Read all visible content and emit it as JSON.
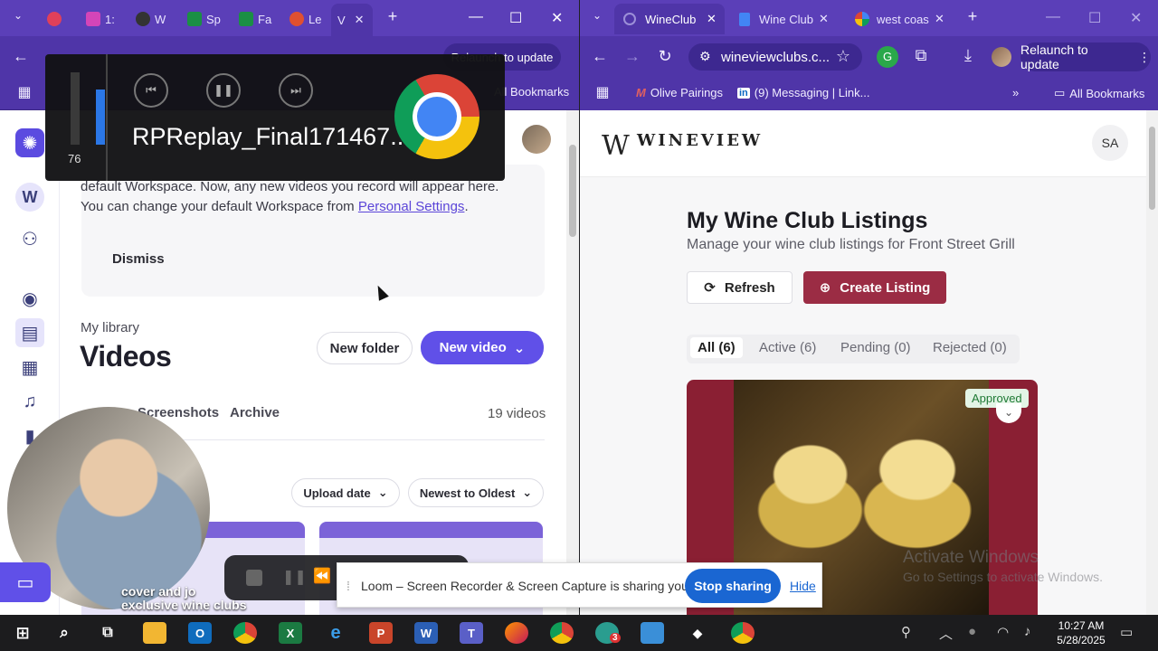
{
  "left_browser": {
    "tabs": [
      {
        "label": "",
        "color": "#e0405a"
      },
      {
        "label": "1:",
        "color": "#d445b8"
      },
      {
        "label": "W",
        "color": "#333333"
      },
      {
        "label": "Sp",
        "color": "#1b8f45"
      },
      {
        "label": "Fa",
        "color": "#1b8f45"
      },
      {
        "label": "Le",
        "color": "#e05030"
      },
      {
        "label": "V",
        "color": "#6a55e0"
      }
    ],
    "update_label": "Relaunch to update",
    "bookmarks_label": "All Bookmarks"
  },
  "media_overlay": {
    "title": "RPReplay_Final171467...",
    "volume": 76,
    "volume_fraction": 0.76
  },
  "loom": {
    "rail_icons": [
      "loom-logo-icon",
      "workspace-icon",
      "add-user-icon",
      "profile-icon",
      "library-icon",
      "calendar-icon",
      "bell-icon",
      "bookmark-icon"
    ],
    "workspace_letter": "W",
    "notice_text_lead": "default Workspace. Now, any new videos you record will appear here. You can change your default Workspace from ",
    "notice_link": "Personal Settings",
    "notice_text_end": ".",
    "dismiss_label": "Dismiss",
    "library_label": "My library",
    "library_title": "Videos",
    "new_folder_label": "New folder",
    "new_video_label": "New video",
    "tabs": [
      "Screenshots",
      "Archive"
    ],
    "video_count": "19 videos",
    "sort_upload": "Upload date",
    "sort_order": "Newest to Oldest",
    "webcam_caption_1": "cover and jo",
    "webcam_caption_2": "exclusive wine clubs"
  },
  "right_browser": {
    "tabs": [
      {
        "label": "WineClub",
        "active": true
      },
      {
        "label": "Wine Club",
        "active": false
      },
      {
        "label": "west coas",
        "active": false
      }
    ],
    "url": "wineviewclubs.c...",
    "relaunch_label": "Relaunch to update",
    "bookmarks": [
      "Olive Pairings",
      "(9) Messaging | Link..."
    ],
    "all_bookmarks": "All Bookmarks"
  },
  "wineview": {
    "logo_mark": "W",
    "logo_text": "WINEVIEW",
    "avatar_initials": "SA",
    "title": "My Wine Club Listings",
    "subtitle": "Manage your wine club listings for Front Street Grill",
    "refresh_label": "Refresh",
    "create_label": "Create Listing",
    "filters": [
      "All (6)",
      "Active (6)",
      "Pending (0)",
      "Rejected (0)"
    ],
    "status_badge": "Approved",
    "brand_color": "#9b2c44",
    "watermark_title": "Activate Windows",
    "watermark_sub": "Go to Settings to activate Windows."
  },
  "share_bar": {
    "text": "Loom – Screen Recorder & Screen Capture is sharing your screen.",
    "stop_label": "Stop sharing",
    "hide_label": "Hide"
  },
  "taskbar": {
    "time": "10:27 AM",
    "date": "5/28/2025",
    "teams_badge": "3"
  }
}
